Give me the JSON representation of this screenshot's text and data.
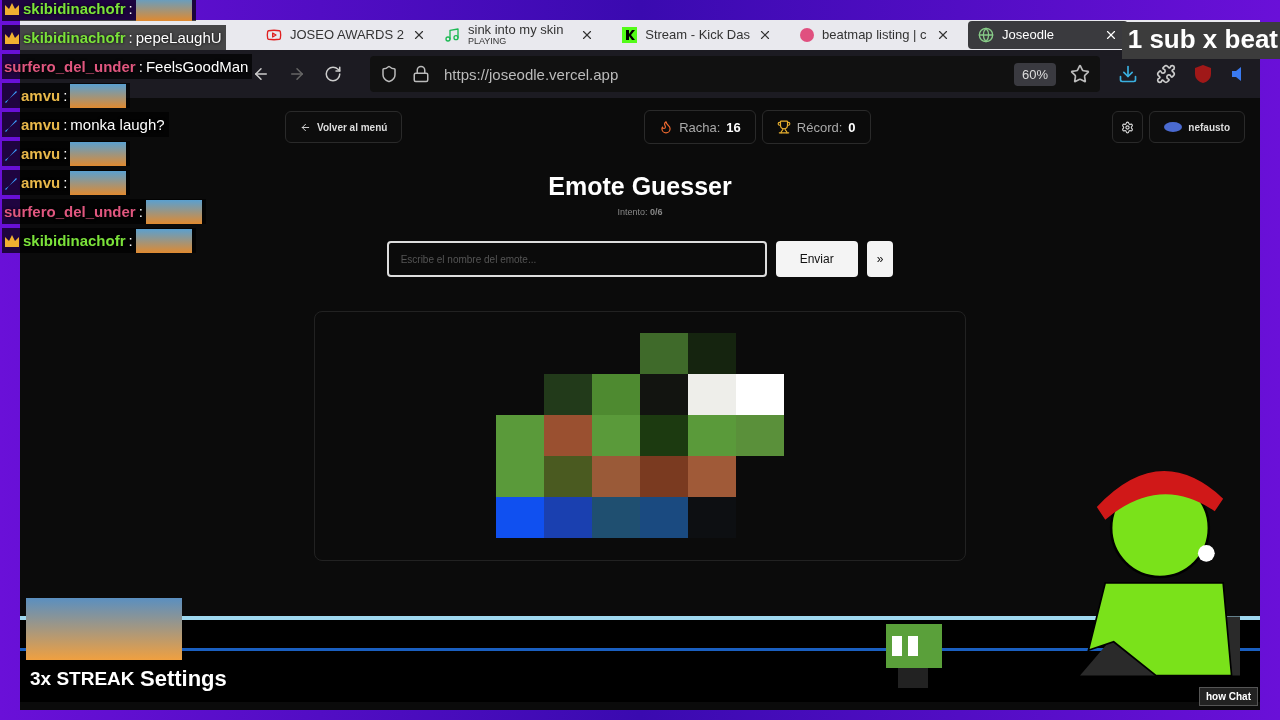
{
  "browser": {
    "tabs": [
      {
        "title": "JOSEO AWARDS 2",
        "selected": false
      },
      {
        "title": "sink into my skin",
        "subtitle": "PLAYING",
        "selected": false
      },
      {
        "title": "Stream - Kick Das",
        "selected": false
      },
      {
        "title": "beatmap listing | c",
        "selected": false
      },
      {
        "title": "Joseodle",
        "selected": true
      }
    ],
    "url": "https://joseodle.vercel.app",
    "zoom": "60%"
  },
  "page": {
    "back_button": "Volver al menú",
    "stats": [
      {
        "kind": "fire",
        "label": "Racha:",
        "value": "16"
      },
      {
        "kind": "trophy",
        "label": "Récord:",
        "value": "0"
      }
    ],
    "user": "nefausto",
    "title": "Emote Guesser",
    "attempt_label": "Intento:",
    "attempt_value": "0/6",
    "input": {
      "placeholder": "Escribe el nombre del emote..."
    },
    "submit_button": "Enviar",
    "skip_button": "»"
  },
  "chat": [
    {
      "kind": "crown",
      "user": "skibidinachofr",
      "separator": ":",
      "color": "#7be23a"
    },
    {
      "kind": "crown",
      "user": "skibidinachofr",
      "separator": ":",
      "color": "#7be23a",
      "text": "pepeLaughU"
    },
    {
      "kind": "plain",
      "user": "surfero_del_under",
      "separator": ":",
      "color": "#e0577f",
      "text": "FeelsGoodMan"
    },
    {
      "kind": "sword",
      "user": "amvu",
      "separator": ":",
      "color": "#e8b84a"
    },
    {
      "kind": "sword",
      "user": "amvu",
      "separator": ":",
      "color": "#e8b84a",
      "text": "monka laugh?"
    },
    {
      "kind": "sword",
      "user": "amvu",
      "separator": ":",
      "color": "#e8b84a"
    },
    {
      "kind": "sword",
      "user": "amvu",
      "separator": ":",
      "color": "#e8b84a"
    },
    {
      "kind": "plain",
      "user": "surfero_del_under",
      "separator": ":",
      "color": "#e0577f"
    },
    {
      "kind": "crown",
      "user": "skibidinachofr",
      "separator": ":",
      "color": "#7be23a"
    }
  ],
  "overlay": {
    "sub_goal": "1 sub x beat",
    "streak": "3x STREAK",
    "settings": "Settings",
    "chat_button": "how Chat"
  }
}
